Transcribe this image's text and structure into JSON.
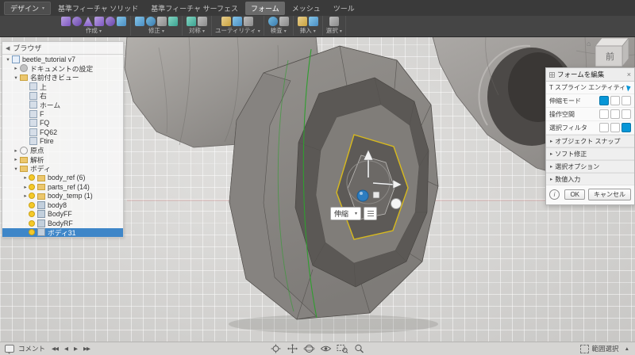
{
  "toolbar": {
    "design_menu": "デザイン",
    "tabs": [
      "基準フィーチャ ソリッド",
      "基準フィーチャ サーフェス",
      "フォーム",
      "メッシュ",
      "ツール"
    ],
    "active_tab": "フォーム",
    "groups": [
      "作成",
      "修正",
      "対称",
      "ユーティリティ",
      "検査",
      "挿入",
      "選択"
    ]
  },
  "browser": {
    "title": "ブラウザ",
    "items": [
      {
        "label": "beetle_tutorial v7"
      },
      {
        "label": "ドキュメントの設定"
      },
      {
        "label": "名前付きビュー"
      },
      {
        "label": "上"
      },
      {
        "label": "右"
      },
      {
        "label": "ホーム"
      },
      {
        "label": "F"
      },
      {
        "label": "FQ"
      },
      {
        "label": "FQ62"
      },
      {
        "label": "Ftire"
      },
      {
        "label": "原点"
      },
      {
        "label": "解析"
      },
      {
        "label": "ボディ"
      },
      {
        "label": "body_ref (6)"
      },
      {
        "label": "parts_ref (14)"
      },
      {
        "label": "body_temp (1)"
      },
      {
        "label": "body8"
      },
      {
        "label": "BodyFF"
      },
      {
        "label": "BodyRF"
      },
      {
        "label": "ボディ31"
      }
    ],
    "selected_item": "ボディ31"
  },
  "dialog": {
    "title": "フォームを編集",
    "entity_label": "T スプライン エンティティ",
    "mode_label": "伸縮モード",
    "space_label": "操作空間",
    "filter_label": "選択フィルタ",
    "sections": [
      "オブジェクト スナップ",
      "ソフト修正",
      "選択オプション",
      "数値入力"
    ],
    "ok": "OK",
    "cancel": "キャンセル"
  },
  "viewcube": {
    "front": "前"
  },
  "mini_toolbar": {
    "mode": "伸縮"
  },
  "bottom": {
    "comment": "コメント",
    "selection": "範囲選択",
    "nav_icons": [
      "fit",
      "pan",
      "orbit",
      "look-at",
      "zoom-window",
      "zoom"
    ]
  },
  "colors": {
    "accent_blue": "#0696d7",
    "highlight_yellow": "#d7b91e",
    "edge_green": "#2f9e2f",
    "selection_row": "#3e86c8",
    "toolbar_dark": "#3a3a3a"
  }
}
